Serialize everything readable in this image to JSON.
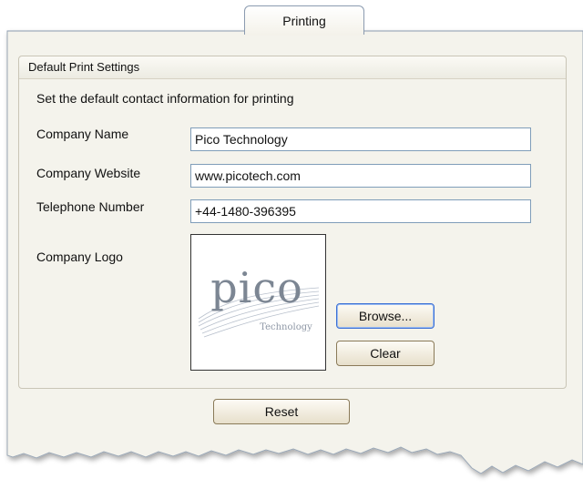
{
  "tab": {
    "label": "Printing"
  },
  "group": {
    "title": "Default Print Settings"
  },
  "description": "Set the default contact information for printing",
  "fields": {
    "company_name": {
      "label": "Company Name",
      "value": "Pico Technology"
    },
    "company_website": {
      "label": "Company Website",
      "value": "www.picotech.com"
    },
    "telephone": {
      "label": "Telephone Number",
      "value": "+44-1480-396395"
    }
  },
  "logo": {
    "label": "Company Logo",
    "wordmark": "pico",
    "tagline": "Technology"
  },
  "buttons": {
    "browse": "Browse...",
    "clear": "Clear",
    "reset": "Reset"
  }
}
